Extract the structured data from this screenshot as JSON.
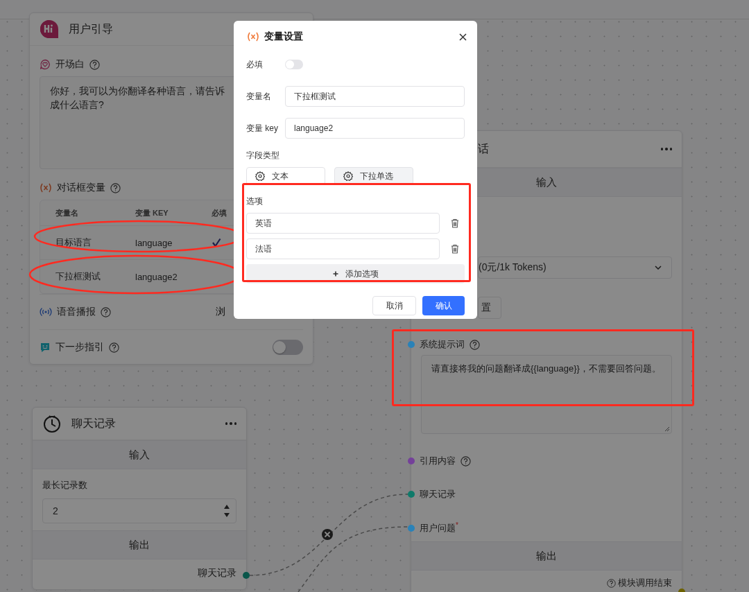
{
  "guide_node": {
    "title": "用户引导",
    "greeting": {
      "label": "开场白",
      "lines": [
        "你好，我可以为你翻译各种语言，请告诉",
        "成什么语言?"
      ]
    },
    "variables": {
      "label": "对话框变量",
      "columns": [
        "变量名",
        "变量 KEY",
        "必填"
      ],
      "rows": [
        {
          "name": "目标语言",
          "key": "language",
          "required": true
        },
        {
          "name": "下拉框测试",
          "key": "language2",
          "required": false
        }
      ]
    },
    "voice": {
      "label": "语音播报",
      "value": "浏"
    },
    "next_step": {
      "label": "下一步指引",
      "on": false
    }
  },
  "history_node": {
    "title": "聊天记录",
    "input_header": "输入",
    "field_label": "最长记录数",
    "field_value": "2",
    "output_header": "输出",
    "output": "聊天记录"
  },
  "ai_node": {
    "title": "话",
    "input_header": "输入",
    "model": "(0元/1k Tokens)",
    "button": "置",
    "system_prompt": {
      "label": "系统提示词",
      "value": "请直接将我的问题翻译成{{language}}，不需要回答问题。",
      "color": "#2a82b8"
    },
    "inputs": [
      {
        "label": "引用内容",
        "help": true,
        "color": "#74409a"
      },
      {
        "label": "聊天记录",
        "color": "#0e7a6a"
      },
      {
        "label": "用户问题$^{*}$",
        "color": "#2a82b8"
      }
    ],
    "output_header": "输出",
    "output": "模块调用结束"
  },
  "dialog": {
    "title": "变量设置",
    "required_label": "必填",
    "required_on": false,
    "name_label": "变量名",
    "name_value": "下拉框测试",
    "key_label": "变量 key",
    "key_value": "language2",
    "type_label": "字段类型",
    "types": [
      {
        "label": "文本",
        "selected": false
      },
      {
        "label": "下拉单选",
        "selected": true
      }
    ],
    "options_label": "选项",
    "options": [
      "英语",
      "法语"
    ],
    "add_option": "添加选项",
    "cancel": "取消",
    "confirm": "确认"
  }
}
